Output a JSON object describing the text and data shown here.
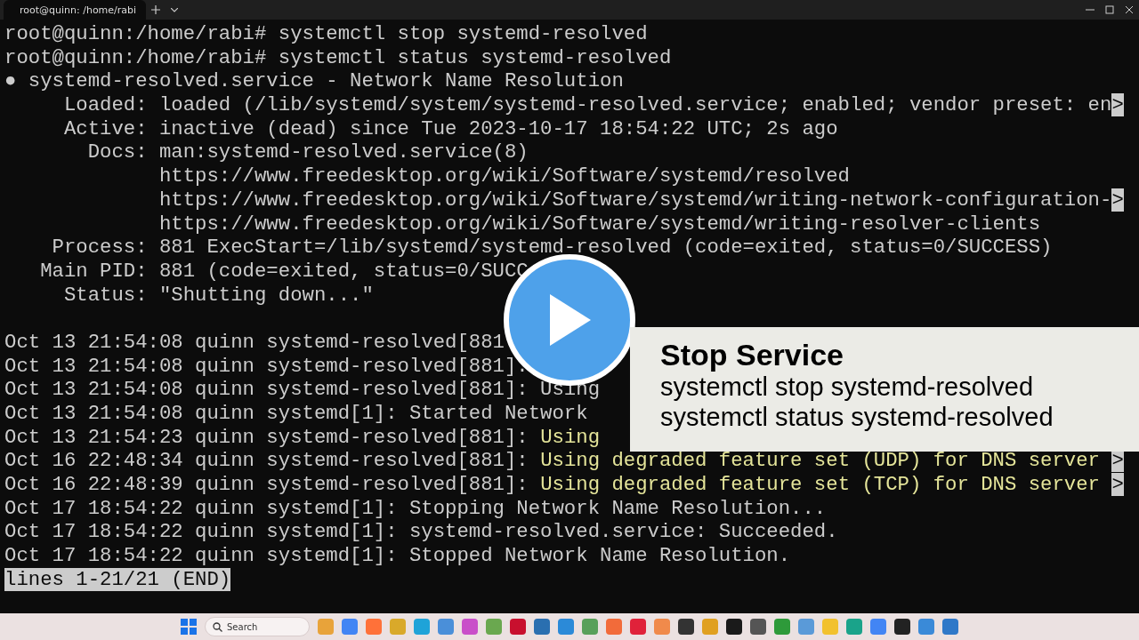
{
  "tab": {
    "title": "root@quinn: /home/rabi"
  },
  "terminal": {
    "lines": [
      [
        {
          "kind": "plain",
          "text": "root@quinn:/home/rabi# systemctl stop systemd-resolved"
        }
      ],
      [
        {
          "kind": "plain",
          "text": "root@quinn:/home/rabi# systemctl status systemd-resolved"
        }
      ],
      [
        {
          "kind": "plain",
          "text": "● systemd-resolved.service - Network Name Resolution"
        }
      ],
      [
        {
          "kind": "plain",
          "text": "     Loaded: loaded (/lib/systemd/system/systemd-resolved.service; enabled; vendor preset: en"
        },
        {
          "kind": "marker",
          "text": ">"
        }
      ],
      [
        {
          "kind": "plain",
          "text": "     Active: inactive (dead) since Tue 2023-10-17 18:54:22 UTC; 2s ago"
        }
      ],
      [
        {
          "kind": "plain",
          "text": "       Docs: man:systemd-resolved.service(8)"
        }
      ],
      [
        {
          "kind": "plain",
          "text": "             https://www.freedesktop.org/wiki/Software/systemd/resolved"
        }
      ],
      [
        {
          "kind": "plain",
          "text": "             https://www.freedesktop.org/wiki/Software/systemd/writing-network-configuration-"
        },
        {
          "kind": "marker",
          "text": ">"
        }
      ],
      [
        {
          "kind": "plain",
          "text": "             https://www.freedesktop.org/wiki/Software/systemd/writing-resolver-clients"
        }
      ],
      [
        {
          "kind": "plain",
          "text": "    Process: 881 ExecStart=/lib/systemd/systemd-resolved (code=exited, status=0/SUCCESS)"
        }
      ],
      [
        {
          "kind": "plain",
          "text": "   Main PID: 881 (code=exited, status=0/SUCC"
        }
      ],
      [
        {
          "kind": "plain",
          "text": "     Status: \"Shutting down...\""
        }
      ],
      [
        {
          "kind": "gap",
          "text": "Oct 13 21:54:08 quinn systemd-resolved[881"
        }
      ],
      [
        {
          "kind": "plain",
          "text": "Oct 13 21:54:08 quinn systemd-resolved[881]:"
        }
      ],
      [
        {
          "kind": "plain",
          "text": "Oct 13 21:54:08 quinn systemd-resolved[881]: Using"
        }
      ],
      [
        {
          "kind": "plain",
          "text": "Oct 13 21:54:08 quinn systemd[1]: Started Network"
        }
      ],
      [
        {
          "kind": "plain",
          "text": "Oct 13 21:54:23 quinn systemd-resolved[881]: "
        },
        {
          "kind": "warning",
          "text": "Using"
        }
      ],
      [
        {
          "kind": "plain",
          "text": "Oct 16 22:48:34 quinn systemd-resolved[881]: "
        },
        {
          "kind": "warning",
          "text": "Using degraded feature set (UDP) for DNS server "
        },
        {
          "kind": "marker",
          "text": ">"
        }
      ],
      [
        {
          "kind": "plain",
          "text": "Oct 16 22:48:39 quinn systemd-resolved[881]: "
        },
        {
          "kind": "warning",
          "text": "Using degraded feature set (TCP) for DNS server "
        },
        {
          "kind": "marker",
          "text": ">"
        }
      ],
      [
        {
          "kind": "plain",
          "text": "Oct 17 18:54:22 quinn systemd[1]: Stopping Network Name Resolution..."
        }
      ],
      [
        {
          "kind": "plain",
          "text": "Oct 17 18:54:22 quinn systemd[1]: systemd-resolved.service: Succeeded."
        }
      ],
      [
        {
          "kind": "plain",
          "text": "Oct 17 18:54:22 quinn systemd[1]: Stopped Network Name Resolution."
        }
      ],
      [
        {
          "kind": "status",
          "text": "lines 1-21/21 (END)"
        }
      ]
    ]
  },
  "caption": {
    "title": "Stop Service",
    "lines": [
      "systemctl stop systemd-resolved",
      "systemctl status systemd-resolved"
    ]
  },
  "taskbar": {
    "search": {
      "placeholder": "Search"
    }
  }
}
